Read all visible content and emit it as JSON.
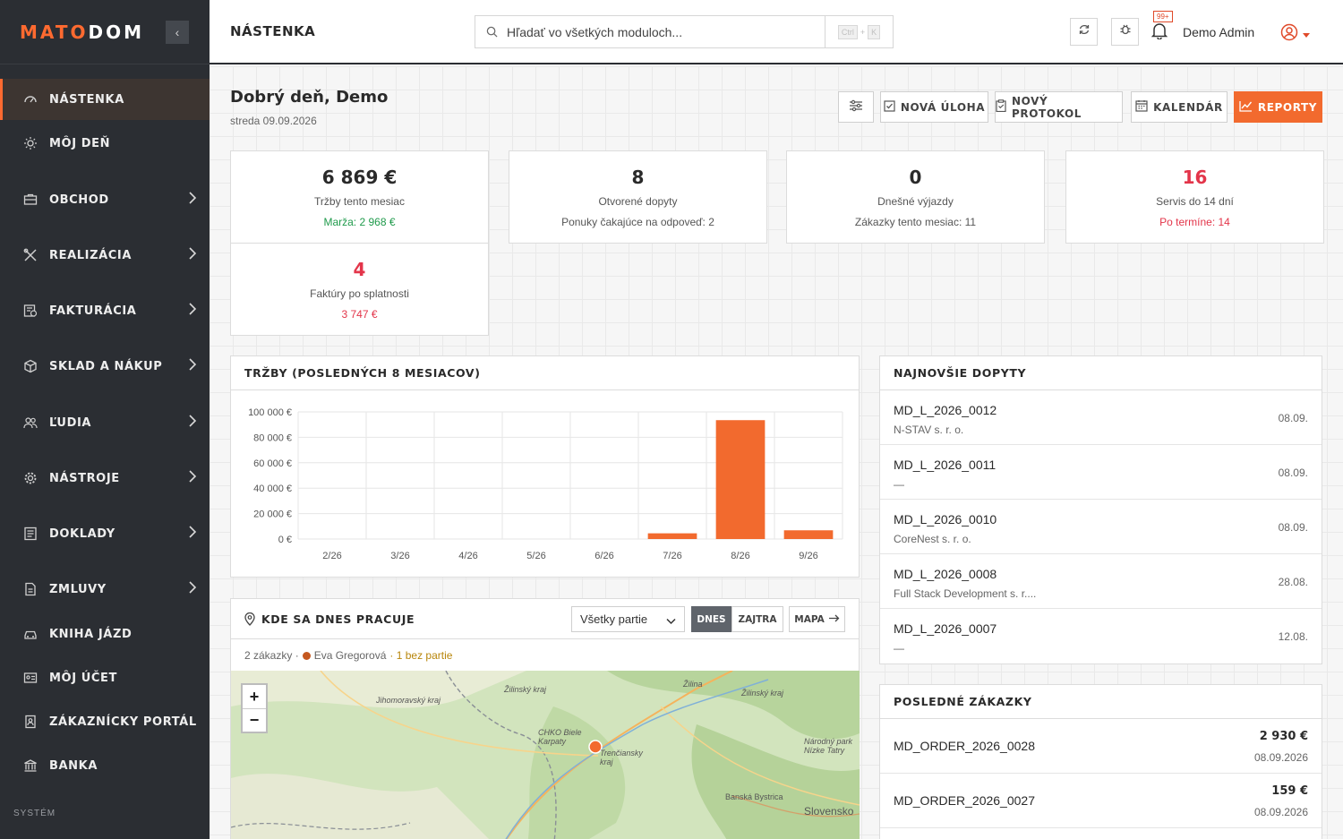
{
  "brand": {
    "logo_a": "MATO",
    "logo_b": "DOM"
  },
  "sidebar": {
    "items": [
      {
        "label": "NÁSTENKA"
      },
      {
        "label": "MÔJ DEŇ"
      },
      {
        "label": "OBCHOD"
      },
      {
        "label": "REALIZÁCIA"
      },
      {
        "label": "FAKTURÁCIA"
      },
      {
        "label": "SKLAD A NÁKUP"
      },
      {
        "label": "ĽUDIA"
      },
      {
        "label": "NÁSTROJE"
      },
      {
        "label": "DOKLADY"
      },
      {
        "label": "ZMLUVY"
      },
      {
        "label": "KNIHA JÁZD"
      },
      {
        "label": "MÔJ ÚČET"
      },
      {
        "label": "ZÁKAZNÍCKY PORTÁL"
      },
      {
        "label": "BANKA"
      }
    ],
    "section_label": "SYSTÉM"
  },
  "header": {
    "title": "NÁSTENKA",
    "search_placeholder": "Hľadať vo všetkých moduloch...",
    "kbd_ctrl": "Ctrl",
    "kbd_plus": "+",
    "kbd_k": "K",
    "notif_badge": "99+",
    "user_name": "Demo Admin"
  },
  "dashboard": {
    "greeting": "Dobrý deň, Demo",
    "date": "streda 09.09.2026",
    "buttons": {
      "new_task": "NOVÁ ÚLOHA",
      "new_protocol": "NOVÝ PROTOKOL",
      "calendar": "KALENDÁR",
      "reports": "REPORTY"
    },
    "stats": [
      {
        "value": "6 869 €",
        "label": "Tržby tento mesiac",
        "sub": "Marža: 2 968 €"
      },
      {
        "value": "8",
        "label": "Otvorené dopyty",
        "sub": "Ponuky čakajúce na odpoveď: 2"
      },
      {
        "value": "0",
        "label": "Dnešné výjazdy",
        "sub": "Zákazky tento mesiac: 11"
      },
      {
        "value": "16",
        "label": "Servis do 14 dní",
        "sub": "Po termíne: 14"
      },
      {
        "value": "4",
        "label": "Faktúry po splatnosti",
        "sub": "3 747 €"
      }
    ]
  },
  "sales_panel": {
    "title": "TRŽBY (POSLEDNÝCH 8 MESIACOV)"
  },
  "chart_data": {
    "type": "bar",
    "categories": [
      "2/26",
      "3/26",
      "4/26",
      "5/26",
      "6/26",
      "7/26",
      "8/26",
      "9/26"
    ],
    "values": [
      0,
      0,
      0,
      0,
      0,
      4500,
      93500,
      6869
    ],
    "ylim": [
      0,
      100000
    ],
    "yticks": [
      "0 €",
      "20 000 €",
      "40 000 €",
      "60 000 €",
      "80 000 €",
      "100 000 €"
    ],
    "grid": true,
    "color": "#f26a2e"
  },
  "work_panel": {
    "title": "KDE SA DNES PRACUJE",
    "select_value": "Všetky partie",
    "tab_today": "DNES",
    "tab_tomorrow": "ZAJTRA",
    "map_button": "MAPA",
    "summary_count": "2 zákazky ·",
    "summary_person": "Eva Gregorová",
    "summary_extra": "· 1 bez partie",
    "map_labels": [
      "Žilinský kraj",
      "Trenčiansky kraj",
      "Jihomoravský kraj",
      "CHKO Biele Karpaty",
      "Žilina",
      "Národný park Nízke Tatry",
      "Banská Bystrica",
      "Slovensko",
      "Žilinský kraj"
    ]
  },
  "inquiries_panel": {
    "title": "NAJNOVŠIE DOPYTY",
    "rows": [
      {
        "code": "MD_L_2026_0012",
        "who": "N-STAV s. r. o.",
        "date": "08.09."
      },
      {
        "code": "MD_L_2026_0011",
        "who": "—",
        "date": "08.09."
      },
      {
        "code": "MD_L_2026_0010",
        "who": "CoreNest s. r. o.",
        "date": "08.09."
      },
      {
        "code": "MD_L_2026_0008",
        "who": "Full Stack Development s. r....",
        "date": "28.08."
      },
      {
        "code": "MD_L_2026_0007",
        "who": "—",
        "date": "12.08."
      }
    ]
  },
  "orders_panel": {
    "title": "POSLEDNÉ ZÁKAZKY",
    "rows": [
      {
        "code": "MD_ORDER_2026_0028",
        "amount": "2 930 €",
        "date": "08.09.2026"
      },
      {
        "code": "MD_ORDER_2026_0027",
        "amount": "159 €",
        "date": "08.09.2026"
      }
    ]
  },
  "colors": {
    "accent": "#f26a2e",
    "sidebar": "#2b2e33",
    "danger": "#e3354a",
    "success": "#1f9a4b"
  }
}
